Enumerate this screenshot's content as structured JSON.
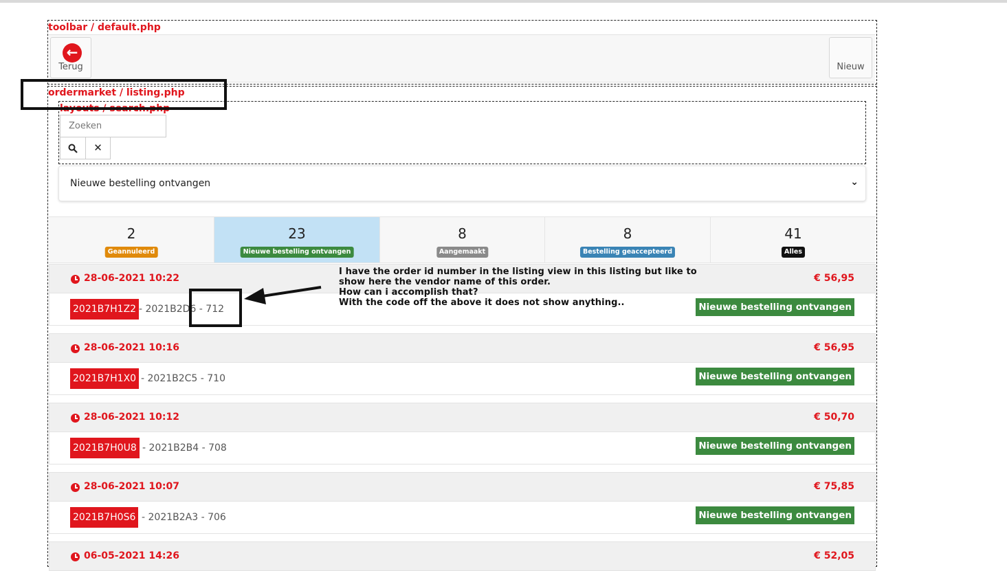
{
  "debug_labels": {
    "toolbar": "toolbar / default.php",
    "listing": "ordermarket / listing.php",
    "search": "layouts / search.php"
  },
  "toolbar": {
    "back_label": "Terug",
    "new_label": "Nieuw"
  },
  "search": {
    "placeholder": "Zoeken",
    "search_icon": "search-icon",
    "clear_icon": "close-icon"
  },
  "status_filter": {
    "selected": "Nieuwe bestelling ontvangen"
  },
  "tabs": [
    {
      "count": "2",
      "label": "Geannuleerd",
      "color": "#e08a0b"
    },
    {
      "count": "23",
      "label": "Nieuwe bestelling ontvangen",
      "color": "#3c8a3f",
      "active": true
    },
    {
      "count": "8",
      "label": "Aangemaakt",
      "color": "#8a8a8a"
    },
    {
      "count": "8",
      "label": "Bestelling geaccepteerd",
      "color": "#3a84b5"
    },
    {
      "count": "41",
      "label": "Alles",
      "color": "#111111"
    }
  ],
  "orders": [
    {
      "date": "28-06-2021 10:22",
      "price": "€ 56,95",
      "code": "2021B7H1Z2",
      "ref": "- 2021B2D6 - 712",
      "status": "Nieuwe bestelling ontvangen"
    },
    {
      "date": "28-06-2021 10:16",
      "price": "€ 56,95",
      "code": "2021B7H1X0",
      "ref": "- 2021B2C5 - 710",
      "status": "Nieuwe bestelling ontvangen"
    },
    {
      "date": "28-06-2021 10:12",
      "price": "€ 50,70",
      "code": "2021B7H0U8",
      "ref": "- 2021B2B4 - 708",
      "status": "Nieuwe bestelling ontvangen"
    },
    {
      "date": "28-06-2021 10:07",
      "price": "€ 75,85",
      "code": "2021B7H0S6",
      "ref": "- 2021B2A3 - 706",
      "status": "Nieuwe bestelling ontvangen"
    },
    {
      "date": "06-05-2021 14:26",
      "price": "€ 52,05"
    }
  ],
  "annotation": {
    "text": "I have the order id number in the listing view in this listing but like to\nshow here the vendor name of this order.\nHow can i accomplish that?\nWith the code off the above it does not show anything.."
  },
  "colors": {
    "accent": "#e0161d",
    "success": "#3c8a3f",
    "active_tab": "#c2e1f5"
  }
}
